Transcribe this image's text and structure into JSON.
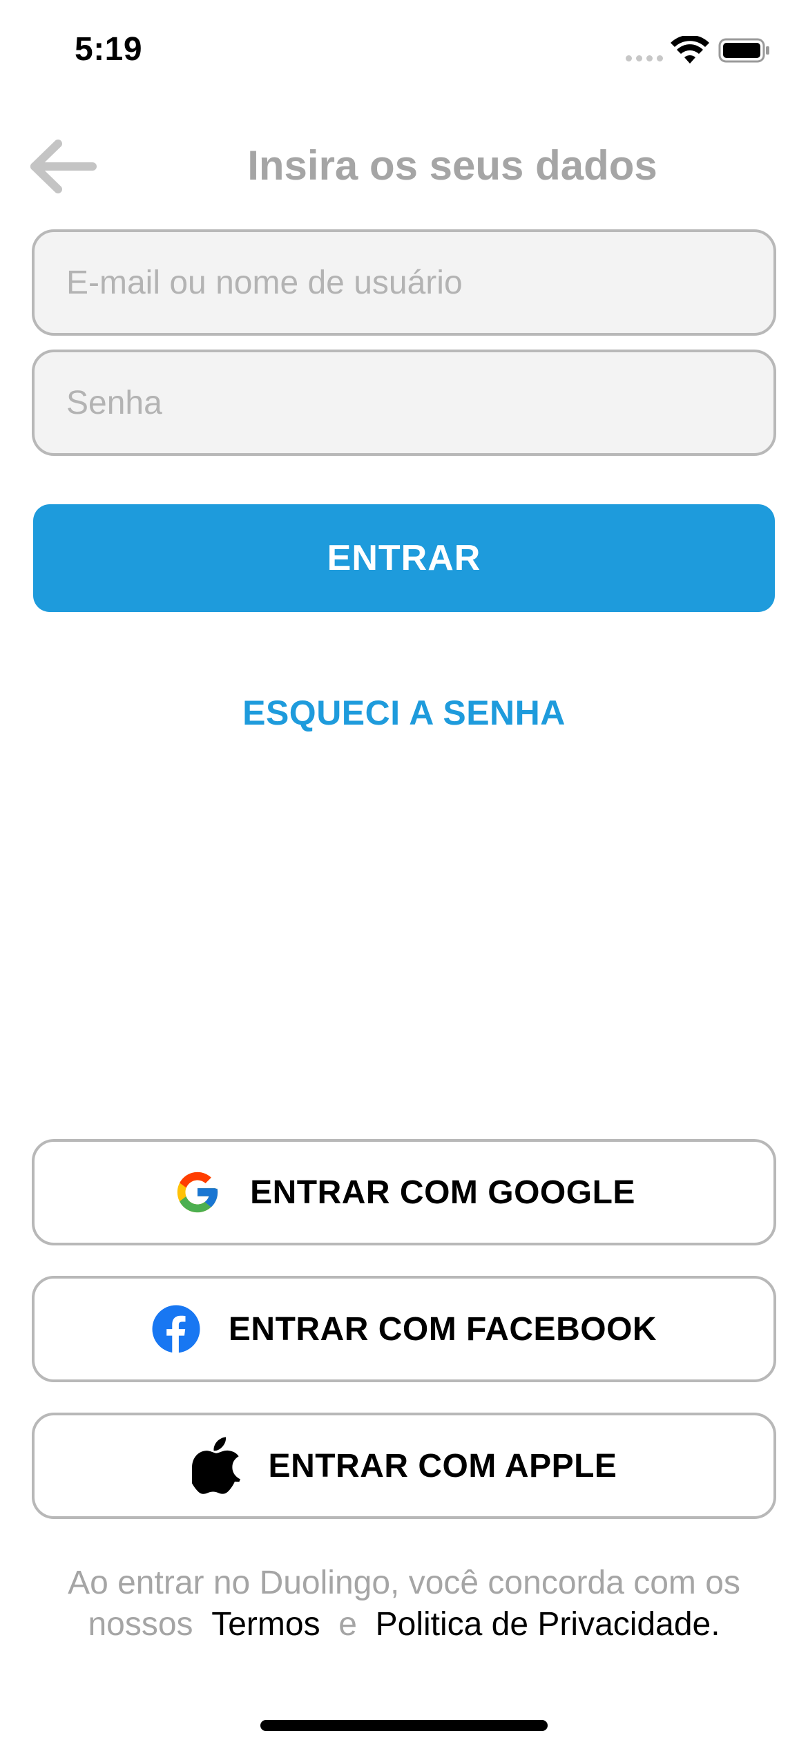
{
  "status_bar": {
    "time": "5:19"
  },
  "header": {
    "back_icon": "arrow-left-icon",
    "title": "Insira os seus dados"
  },
  "form": {
    "email_placeholder": "E-mail ou nome de usuário",
    "email_value": "",
    "password_placeholder": "Senha",
    "password_value": "",
    "login_label": "ENTRAR",
    "forgot_label": "ESQUECI A SENHA"
  },
  "social": {
    "google_label": "ENTRAR COM GOOGLE",
    "facebook_label": "ENTRAR COM FACEBOOK",
    "apple_label": "ENTRAR COM APPLE"
  },
  "terms": {
    "prefix": "Ao entrar no Duolingo, você concorda com os nossos",
    "terms_link": "Termos",
    "joiner": "e",
    "privacy_link": "Politica de Privacidade."
  },
  "colors": {
    "accent": "#1e9bdc",
    "title_gray": "#a5a5a5",
    "border_gray": "#b8b8b8",
    "input_bg": "#f3f3f3"
  }
}
